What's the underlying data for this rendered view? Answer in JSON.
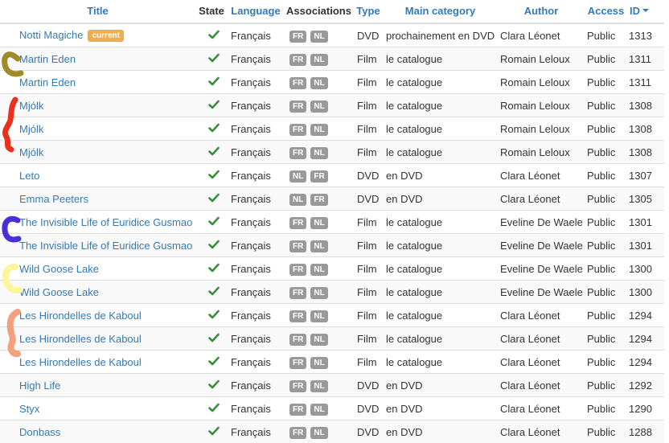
{
  "headers": {
    "title": "Title",
    "state": "State",
    "language": "Language",
    "associations": "Associations",
    "type": "Type",
    "main_category": "Main category",
    "author": "Author",
    "access": "Access",
    "id": "ID"
  },
  "sort": {
    "column": "ID",
    "direction": "descending"
  },
  "current_badge": "current",
  "colors": {
    "link": "#337ab7",
    "check": "#3c8d3c",
    "current_badge": "#f0ad4e",
    "language_badge": "#999999",
    "annotation_brown": "#a08a2c",
    "annotation_red": "#e8321e",
    "annotation_blue": "#4a2fd6",
    "annotation_yellow": "#fbf59e",
    "annotation_salmon": "#f2a07e"
  },
  "rows": [
    {
      "title": "Notti Magiche",
      "current": true,
      "state": "published-check-icon",
      "language": "Français",
      "associations": [
        "FR",
        "NL"
      ],
      "type": "DVD",
      "category": "prochainement en DVD",
      "author": "Clara Léonet",
      "access": "Public",
      "id": "1313"
    },
    {
      "title": "Martin Eden",
      "current": false,
      "state": "published-check-icon",
      "language": "Français",
      "associations": [
        "FR",
        "NL"
      ],
      "type": "Film",
      "category": "le catalogue",
      "author": "Romain Leloux",
      "access": "Public",
      "id": "1311"
    },
    {
      "title": "Martin Eden",
      "current": false,
      "state": "published-check-icon",
      "language": "Français",
      "associations": [
        "FR",
        "NL"
      ],
      "type": "Film",
      "category": "le catalogue",
      "author": "Romain Leloux",
      "access": "Public",
      "id": "1311"
    },
    {
      "title": "Mjólk",
      "current": false,
      "state": "published-check-icon",
      "language": "Français",
      "associations": [
        "FR",
        "NL"
      ],
      "type": "Film",
      "category": "le catalogue",
      "author": "Romain Leloux",
      "access": "Public",
      "id": "1308"
    },
    {
      "title": "Mjólk",
      "current": false,
      "state": "published-check-icon",
      "language": "Français",
      "associations": [
        "FR",
        "NL"
      ],
      "type": "Film",
      "category": "le catalogue",
      "author": "Romain Leloux",
      "access": "Public",
      "id": "1308"
    },
    {
      "title": "Mjólk",
      "current": false,
      "state": "published-check-icon",
      "language": "Français",
      "associations": [
        "FR",
        "NL"
      ],
      "type": "Film",
      "category": "le catalogue",
      "author": "Romain Leloux",
      "access": "Public",
      "id": "1308"
    },
    {
      "title": "Leto",
      "current": false,
      "state": "published-check-icon",
      "language": "Français",
      "associations": [
        "NL",
        "FR"
      ],
      "type": "DVD",
      "category": "en DVD",
      "author": "Clara Léonet",
      "access": "Public",
      "id": "1307"
    },
    {
      "title": "Emma Peeters",
      "current": false,
      "state": "published-check-icon",
      "language": "Français",
      "associations": [
        "NL",
        "FR"
      ],
      "type": "DVD",
      "category": "en DVD",
      "author": "Clara Léonet",
      "access": "Public",
      "id": "1305"
    },
    {
      "title": "The Invisible Life of Euridice Gusmao",
      "current": false,
      "state": "published-check-icon",
      "language": "Français",
      "associations": [
        "FR",
        "NL"
      ],
      "type": "Film",
      "category": "le catalogue",
      "author": "Eveline De Waele",
      "access": "Public",
      "id": "1301"
    },
    {
      "title": "The Invisible Life of Euridice Gusmao",
      "current": false,
      "state": "published-check-icon",
      "language": "Français",
      "associations": [
        "FR",
        "NL"
      ],
      "type": "Film",
      "category": "le catalogue",
      "author": "Eveline De Waele",
      "access": "Public",
      "id": "1301"
    },
    {
      "title": "Wild Goose Lake",
      "current": false,
      "state": "published-check-icon",
      "language": "Français",
      "associations": [
        "FR",
        "NL"
      ],
      "type": "Film",
      "category": "le catalogue",
      "author": "Eveline De Waele",
      "access": "Public",
      "id": "1300"
    },
    {
      "title": "Wild Goose Lake",
      "current": false,
      "state": "published-check-icon",
      "language": "Français",
      "associations": [
        "FR",
        "NL"
      ],
      "type": "Film",
      "category": "le catalogue",
      "author": "Eveline De Waele",
      "access": "Public",
      "id": "1300"
    },
    {
      "title": "Les Hirondelles de Kaboul",
      "current": false,
      "state": "published-check-icon",
      "language": "Français",
      "associations": [
        "FR",
        "NL"
      ],
      "type": "Film",
      "category": "le catalogue",
      "author": "Clara Léonet",
      "access": "Public",
      "id": "1294"
    },
    {
      "title": "Les Hirondelles de Kaboul",
      "current": false,
      "state": "published-check-icon",
      "language": "Français",
      "associations": [
        "FR",
        "NL"
      ],
      "type": "Film",
      "category": "le catalogue",
      "author": "Clara Léonet",
      "access": "Public",
      "id": "1294"
    },
    {
      "title": "Les Hirondelles de Kaboul",
      "current": false,
      "state": "published-check-icon",
      "language": "Français",
      "associations": [
        "FR",
        "NL"
      ],
      "type": "Film",
      "category": "le catalogue",
      "author": "Clara Léonet",
      "access": "Public",
      "id": "1294"
    },
    {
      "title": "High Life",
      "current": false,
      "state": "published-check-icon",
      "language": "Français",
      "associations": [
        "FR",
        "NL"
      ],
      "type": "DVD",
      "category": "en DVD",
      "author": "Clara Léonet",
      "access": "Public",
      "id": "1292"
    },
    {
      "title": "Styx",
      "current": false,
      "state": "published-check-icon",
      "language": "Français",
      "associations": [
        "FR",
        "NL"
      ],
      "type": "DVD",
      "category": "en DVD",
      "author": "Clara Léonet",
      "access": "Public",
      "id": "1290"
    },
    {
      "title": "Donbass",
      "current": false,
      "state": "published-check-icon",
      "language": "Français",
      "associations": [
        "FR",
        "NL"
      ],
      "type": "DVD",
      "category": "en DVD",
      "author": "Clara Léonet",
      "access": "Public",
      "id": "1288"
    }
  ]
}
